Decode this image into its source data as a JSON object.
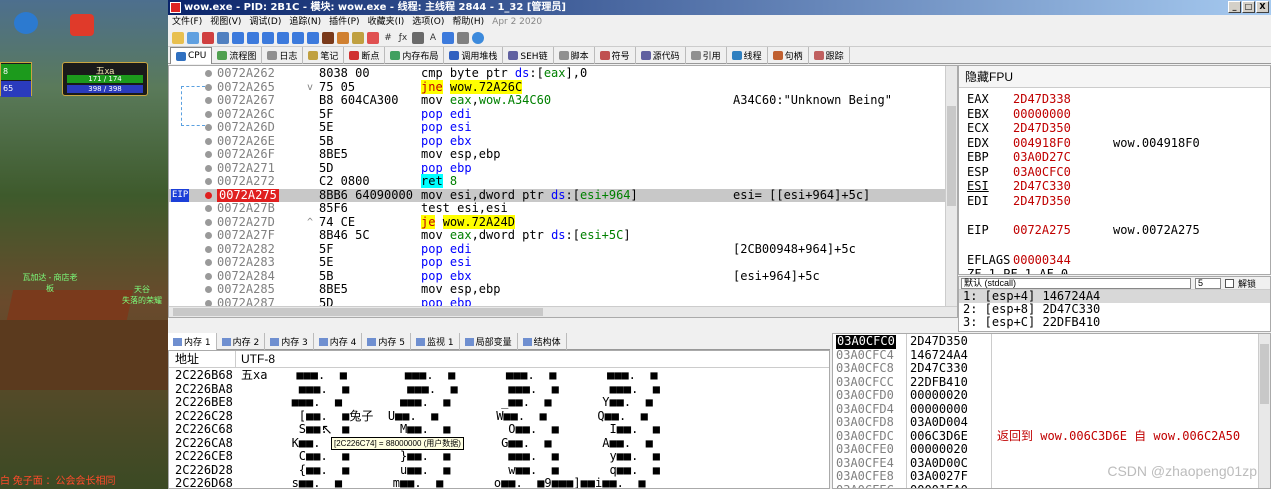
{
  "window": {
    "title": "wow.exe - PID: 2B1C - 模块: wow.exe - 线程: 主线程 2844 - 1_32 [管理员]",
    "controls": [
      "_",
      "□",
      "X"
    ]
  },
  "menu": {
    "items": [
      "文件(F)",
      "视图(V)",
      "调试(D)",
      "追踪(N)",
      "插件(P)",
      "收藏夹(I)",
      "选项(O)",
      "帮助(H)"
    ],
    "build_date": "Apr 2 2020"
  },
  "tabs": [
    {
      "label": "CPU",
      "color": "#3070c0",
      "active": true
    },
    {
      "label": "流程图",
      "color": "#50a050"
    },
    {
      "label": "日志",
      "color": "#909090"
    },
    {
      "label": "笔记",
      "color": "#c0a040"
    },
    {
      "label": "断点",
      "color": "#d03030"
    },
    {
      "label": "内存布局",
      "color": "#40a060"
    },
    {
      "label": "调用堆栈",
      "color": "#3060c0"
    },
    {
      "label": "SEH链",
      "color": "#6060a0"
    },
    {
      "label": "脚本",
      "color": "#909090"
    },
    {
      "label": "符号",
      "color": "#c05050"
    },
    {
      "label": "源代码",
      "color": "#6060a0"
    },
    {
      "label": "引用",
      "color": "#909090"
    },
    {
      "label": "线程",
      "color": "#3080c0"
    },
    {
      "label": "句柄",
      "color": "#c06030"
    },
    {
      "label": "跟踪",
      "color": "#c06060"
    }
  ],
  "disasm": {
    "rows": [
      {
        "addr": "0072A262",
        "bytes": "8038 00",
        "arrow": "",
        "asm": [
          {
            "t": "cmp byte ptr "
          },
          {
            "t": "ds",
            "c": "k-blue"
          },
          {
            "t": ":["
          },
          {
            "t": "eax",
            "c": "k-grn"
          },
          {
            "t": "],0"
          }
        ],
        "cmt": ""
      },
      {
        "addr": "0072A265",
        "bytes": "75 05",
        "arrow": "v",
        "asm": [
          {
            "t": "jne",
            "c": "hl-y k-red"
          },
          {
            "t": " "
          },
          {
            "t": "wow.72A26C",
            "c": "hl-y"
          }
        ],
        "cmt": ""
      },
      {
        "addr": "0072A267",
        "bytes": "B8 604CA300",
        "arrow": "",
        "asm": [
          {
            "t": "mov "
          },
          {
            "t": "eax",
            "c": "k-grn"
          },
          {
            "t": ","
          },
          {
            "t": "wow.A34C60",
            "c": "k-grn"
          }
        ],
        "cmt": "A34C60:\"Unknown Being\""
      },
      {
        "addr": "0072A26C",
        "bytes": "5F",
        "arrow": "",
        "asm": [
          {
            "t": "pop edi",
            "c": "k-blue"
          }
        ],
        "cmt": ""
      },
      {
        "addr": "0072A26D",
        "bytes": "5E",
        "arrow": "",
        "asm": [
          {
            "t": "pop esi",
            "c": "k-blue"
          }
        ],
        "cmt": ""
      },
      {
        "addr": "0072A26E",
        "bytes": "5B",
        "arrow": "",
        "asm": [
          {
            "t": "pop ebx",
            "c": "k-blue"
          }
        ],
        "cmt": ""
      },
      {
        "addr": "0072A26F",
        "bytes": "8BE5",
        "arrow": "",
        "asm": [
          {
            "t": "mov esp,ebp"
          }
        ],
        "cmt": ""
      },
      {
        "addr": "0072A271",
        "bytes": "5D",
        "arrow": "",
        "asm": [
          {
            "t": "pop ebp",
            "c": "k-blue"
          }
        ],
        "cmt": ""
      },
      {
        "addr": "0072A272",
        "bytes": "C2 0800",
        "arrow": "",
        "asm": [
          {
            "t": "ret",
            "c": "hl-c"
          },
          {
            "t": " "
          },
          {
            "t": "8",
            "c": "k-grn"
          }
        ],
        "cmt": ""
      },
      {
        "addr": "0072A275",
        "bytes": "8BB6 64090000",
        "arrow": "",
        "sel": true,
        "eip": "EIP",
        "asm": [
          {
            "t": "mov esi,dword ptr "
          },
          {
            "t": "ds",
            "c": "k-blue"
          },
          {
            "t": ":["
          },
          {
            "t": "esi+964",
            "c": "k-grn"
          },
          {
            "t": "]"
          }
        ],
        "cmt": "esi= [[esi+964]+5c]"
      },
      {
        "addr": "0072A27B",
        "bytes": "85F6",
        "arrow": "",
        "asm": [
          {
            "t": "test esi,esi"
          }
        ],
        "cmt": ""
      },
      {
        "addr": "0072A27D",
        "bytes": "74 CE",
        "arrow": "^",
        "asm": [
          {
            "t": "je",
            "c": "hl-y k-red"
          },
          {
            "t": " "
          },
          {
            "t": "wow.72A24D",
            "c": "hl-y"
          }
        ],
        "cmt": ""
      },
      {
        "addr": "0072A27F",
        "bytes": "8B46 5C",
        "arrow": "",
        "asm": [
          {
            "t": "mov "
          },
          {
            "t": "eax",
            "c": "k-grn"
          },
          {
            "t": ",dword ptr "
          },
          {
            "t": "ds",
            "c": "k-blue"
          },
          {
            "t": ":["
          },
          {
            "t": "esi+5C",
            "c": "k-grn"
          },
          {
            "t": "]"
          }
        ],
        "cmt": ""
      },
      {
        "addr": "0072A282",
        "bytes": "5F",
        "arrow": "",
        "asm": [
          {
            "t": "pop edi",
            "c": "k-blue"
          }
        ],
        "cmt": "[2CB00948+964]+5c"
      },
      {
        "addr": "0072A283",
        "bytes": "5E",
        "arrow": "",
        "asm": [
          {
            "t": "pop esi",
            "c": "k-blue"
          }
        ],
        "cmt": ""
      },
      {
        "addr": "0072A284",
        "bytes": "5B",
        "arrow": "",
        "asm": [
          {
            "t": "pop ebx",
            "c": "k-blue"
          }
        ],
        "cmt": "[esi+964]+5c"
      },
      {
        "addr": "0072A285",
        "bytes": "8BE5",
        "arrow": "",
        "asm": [
          {
            "t": "mov esp,ebp"
          }
        ],
        "cmt": ""
      },
      {
        "addr": "0072A287",
        "bytes": "5D",
        "arrow": "",
        "asm": [
          {
            "t": "pop ebp",
            "c": "k-blue"
          }
        ],
        "cmt": ""
      },
      {
        "addr": "0072A288",
        "bytes": "C2 0800",
        "arrow": "",
        "asm": [
          {
            "t": "ret",
            "c": "hl-c"
          },
          {
            "t": " "
          },
          {
            "t": "8",
            "c": "k-grn"
          }
        ],
        "cmt": ""
      }
    ]
  },
  "registers": {
    "header": "隐藏FPU",
    "rows": [
      {
        "name": "EAX",
        "val": "2D47D338",
        "cmt": ""
      },
      {
        "name": "EBX",
        "val": "00000000",
        "cmt": ""
      },
      {
        "name": "ECX",
        "val": "2D47D350",
        "cmt": ""
      },
      {
        "name": "EDX",
        "val": "004918F0",
        "cmt": "wow.004918F0"
      },
      {
        "name": "EBP",
        "val": "03A0D27C",
        "cmt": ""
      },
      {
        "name": "ESP",
        "val": "03A0CFC0",
        "cmt": ""
      },
      {
        "name": "ESI",
        "val": "2D47C330",
        "cmt": ""
      },
      {
        "name": "EDI",
        "val": "2D47D350",
        "cmt": ""
      },
      {
        "name": "EIP",
        "val": "0072A275",
        "cmt": "wow.0072A275",
        "gap": true
      },
      {
        "name": "EFLAGS",
        "val": "00000344",
        "cmt": "",
        "gap": true
      },
      {
        "name": "ZF 1  PF 1  AF 0",
        "val": "",
        "cmt": ""
      }
    ]
  },
  "args": {
    "convention": "默认 (stdcall)",
    "count": "5",
    "unlock_label": "解锁",
    "rows": [
      "1: [esp+4]  146724A4",
      "2: [esp+8]  2D47C330",
      "3: [esp+C]  22DFB410"
    ]
  },
  "memtabs": [
    {
      "label": "内存 1",
      "active": true
    },
    {
      "label": "内存 2"
    },
    {
      "label": "内存 3"
    },
    {
      "label": "内存 4"
    },
    {
      "label": "内存 5"
    },
    {
      "label": "监视 1"
    },
    {
      "label": "局部变量"
    },
    {
      "label": "结构体"
    }
  ],
  "dump": {
    "col_addr": "地址",
    "col_text": "UTF-8",
    "rows": [
      {
        "addr": "2C226B68",
        "text": "五xa    ■■■.  ■        ■■■.  ■       ■■■.  ■       ■■■.  ■"
      },
      {
        "addr": "2C226BA8",
        "text": "        ■■■.  ■        ■■■.  ■       ■■■.  ■       ■■■.  ■"
      },
      {
        "addr": "2C226BE8",
        "text": "       ■■■.  ■        ■■■.  ■       _■■.  ■       Y■■.  ■"
      },
      {
        "addr": "2C226C28",
        "text": "        [■■.  ■兔子  U■■.  ■        W■■.  ■       Q■■.  ■"
      },
      {
        "addr": "2C226C68",
        "text": "        S■■.  ■       M■■.  ■        O■■.  ■       I■■.  ■"
      },
      {
        "addr": "2C226CA8",
        "text": "       K■■.  ■       E■■.  ■        G■■.  ■       A■■.  ■"
      },
      {
        "addr": "2C226CE8",
        "text": "        C■■.  ■       }■■.  ■        ■■■.  ■       y■■.  ■"
      },
      {
        "addr": "2C226D28",
        "text": "        {■■.  ■       u■■.  ■        w■■.  ■       q■■.  ■"
      },
      {
        "addr": "2C226D68",
        "text": "       s■■.  ■       m■■.  ■       o■■.  ■9■■■]■■i■■.  ■"
      }
    ],
    "tooltip": "[2C226C74] = 88000000 (用户数据)"
  },
  "stack": {
    "rows": [
      {
        "addr": "03A0CFC0",
        "val": "2D47D350",
        "cmt": "",
        "sel": true
      },
      {
        "addr": "03A0CFC4",
        "val": "146724A4",
        "cmt": ""
      },
      {
        "addr": "03A0CFC8",
        "val": "2D47C330",
        "cmt": ""
      },
      {
        "addr": "03A0CFCC",
        "val": "22DFB410",
        "cmt": ""
      },
      {
        "addr": "03A0CFD0",
        "val": "00000020",
        "cmt": ""
      },
      {
        "addr": "03A0CFD4",
        "val": "00000000",
        "cmt": ""
      },
      {
        "addr": "03A0CFD8",
        "val": "03A0D004",
        "cmt": ""
      },
      {
        "addr": "03A0CFDC",
        "val": "006C3D6E",
        "cmt": "返回到 wow.006C3D6E 自 wow.006C2A50"
      },
      {
        "addr": "03A0CFE0",
        "val": "00000020",
        "cmt": ""
      },
      {
        "addr": "03A0CFE4",
        "val": "03A0D00C",
        "cmt": ""
      },
      {
        "addr": "03A0CFE8",
        "val": "03A0027F",
        "cmt": ""
      },
      {
        "addr": "03A0CFEC",
        "val": "00001EA0",
        "cmt": ""
      }
    ]
  },
  "game": {
    "unit_name": "五xa",
    "hp": "171 / 174",
    "mp": "398 / 398",
    "left_hp": "8",
    "left_mp": "65",
    "npc1": "瓦加达 - 商店老板",
    "npc2": "天谷\n失落的荣耀",
    "chat": "白  兔子面  ：公会会长相同"
  },
  "watermark": "CSDN @zhaopeng01zp"
}
